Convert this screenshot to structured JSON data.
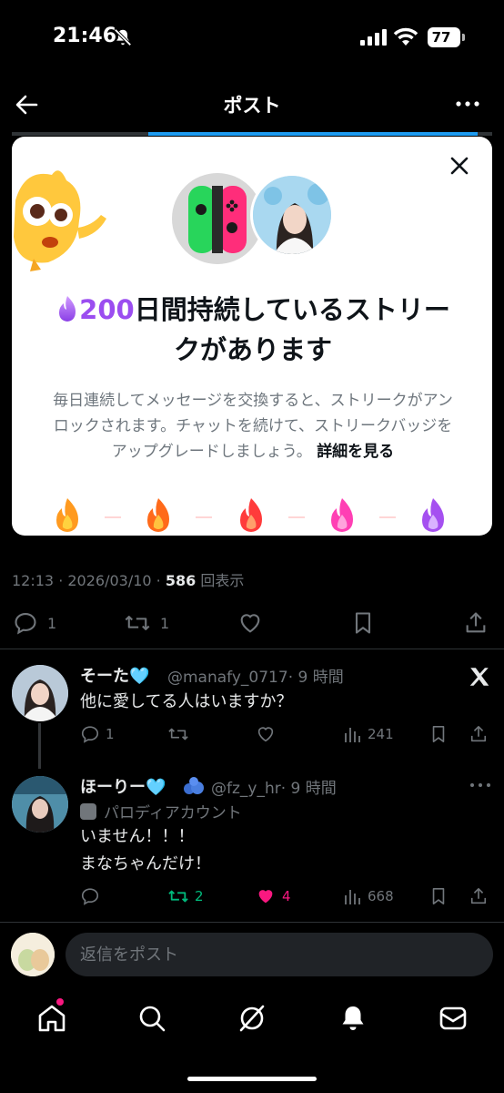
{
  "status": {
    "time": "21:46",
    "battery": "77"
  },
  "header": {
    "title": "ポスト"
  },
  "card": {
    "headline_prefix": "",
    "streak_count": "200",
    "headline_rest": "日間持続しているストリークがあります",
    "description": "毎日連続してメッセージを交換すると、ストリークがアンロックされます。チャットを続けて、ストリークバッジをアップグレードしましょう。",
    "detail_link": "詳細を見る"
  },
  "post_meta": {
    "time": "12:13",
    "date": "2026/03/10",
    "views": "586",
    "views_label": "回表示"
  },
  "post_actions": {
    "replies": "1",
    "reposts": "1"
  },
  "replies": [
    {
      "name": "そーた🩵",
      "handle": "@manafy_0717",
      "time": "· 9 時間",
      "text": "他に愛してる人はいますか？",
      "replies": "1",
      "views": "241"
    },
    {
      "name": "ほーりー🩵",
      "handle": "@fz_y_hr",
      "time": "· 9 時間",
      "parody": "パロディアカウント",
      "text": "いません！！！\nまなちゃんだけ！",
      "reposts": "2",
      "likes": "4",
      "views": "668"
    }
  ],
  "compose": {
    "placeholder": "返信をポスト"
  },
  "colors": {
    "accent": "#1d9bf0",
    "like": "#f91880",
    "repost": "#00ba7c",
    "streak": "#9b4df0"
  }
}
